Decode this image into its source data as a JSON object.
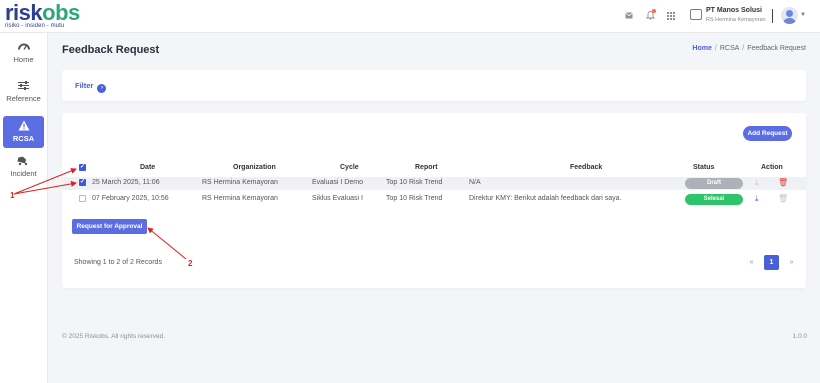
{
  "brand": {
    "logo_risk": "risk",
    "logo_obs": "obs",
    "tagline": "risiko - insiden - mutu"
  },
  "header": {
    "icons": [
      "mail-icon",
      "bell-icon",
      "apps-grid-icon"
    ],
    "org_name": "PT Manos Solusi",
    "org_sub": "RS Hermina Kemayoran"
  },
  "sidebar": {
    "items": [
      {
        "label": "Home",
        "icon": "dashboard-icon"
      },
      {
        "label": "Reference",
        "icon": "sliders-icon"
      },
      {
        "label": "RCSA",
        "icon": "warning-icon",
        "active": true
      },
      {
        "label": "Incident",
        "icon": "car-crash-icon"
      }
    ]
  },
  "page": {
    "title": "Feedback Request",
    "breadcrumb": {
      "home": "Home",
      "mid": "RCSA",
      "current": "Feedback Request",
      "separator": "/"
    }
  },
  "filter": {
    "label": "Filter"
  },
  "table": {
    "add_button": "Add Request",
    "columns": [
      "Date",
      "Organization",
      "Cycle",
      "Report",
      "Feedback",
      "Status",
      "Action"
    ],
    "rows": [
      {
        "checked": true,
        "date": "25 March 2025, 11:06",
        "organization": "RS Hermina Kemayoran",
        "cycle": "Evaluasi I Demo",
        "report": "Top 10 Risk Trend",
        "feedback": "N/A",
        "status": "Draft"
      },
      {
        "checked": false,
        "date": "07 February 2025, 10:56",
        "organization": "RS Hermina Kemayoran",
        "cycle": "Siklus Evaluasi I",
        "report": "Top 10 Risk Trend",
        "feedback": "Direktur KMY: Berikut adalah feedback dari saya.",
        "status": "Selesai"
      }
    ],
    "approve_button": "Request for Approval",
    "records_text": "Showing 1 to 2 of 2 Records",
    "pagination": {
      "prev": "«",
      "current": "1",
      "next": "»"
    }
  },
  "annotations": {
    "one": "1",
    "two": "2"
  },
  "footer": {
    "copyright": "© 2025 Riskobs. All rights reserved.",
    "version": "1.0.0"
  },
  "colors": {
    "primary": "#5b6ee1",
    "draft": "#aeb1b7",
    "selesai": "#2ec56a",
    "delete": "#e53935",
    "annotation": "#e02020"
  }
}
